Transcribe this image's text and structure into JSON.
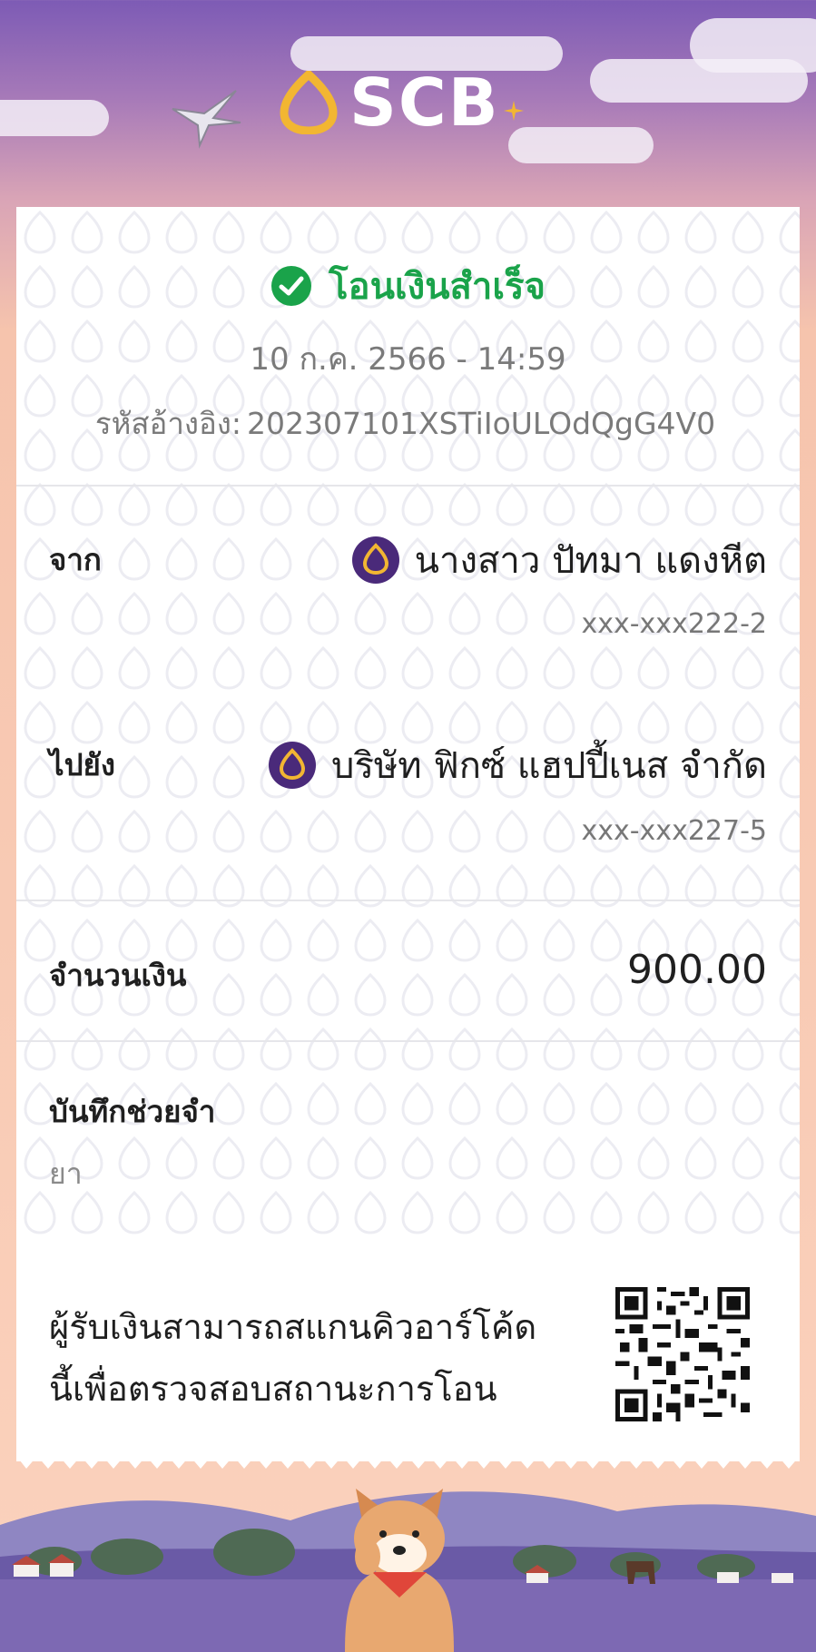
{
  "brand": {
    "name": "SCB"
  },
  "status": {
    "text": "โอนเงินสำเร็จ",
    "color": "#1aa34a"
  },
  "datetime": "10 ก.ค. 2566 - 14:59",
  "reference": {
    "label": "รหัสอ้างอิง:",
    "value": "202307101XSTiIoULOdQgG4V0"
  },
  "from": {
    "label": "จาก",
    "name": "นางสาว ปัทมา แดงหีต",
    "account": "xxx-xxx222-2"
  },
  "to": {
    "label": "ไปยัง",
    "name": "บริษัท ฟิกซ์ แฮปปี้เนส จำกัด",
    "account": "xxx-xxx227-5"
  },
  "amount": {
    "label": "จำนวนเงิน",
    "value": "900.00"
  },
  "memo": {
    "label": "บันทึกช่วยจำ",
    "value": "ยา"
  },
  "qr": {
    "text_line1": "ผู้รับเงินสามารถสแกนคิวอาร์โค้ด",
    "text_line2": "นี้เพื่อตรวจสอบสถานะการโอน"
  },
  "colors": {
    "brand_purple": "#4a2a7a",
    "brand_gold": "#f2b632",
    "success_green": "#1aa34a"
  }
}
